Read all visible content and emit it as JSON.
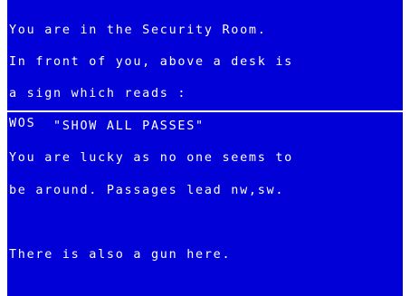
{
  "room_description": {
    "lines": [
      "You are in the Security Room.",
      "In front of you, above a desk is",
      "a sign which reads :",
      "     \"SHOW ALL PASSES\"",
      "You are lucky as no one seems to",
      "be around. Passages lead nw,sw."
    ],
    "object_line": "There is also a gun here."
  },
  "command_input": {
    "text": "WOS"
  },
  "colors": {
    "background": "#0000d7",
    "text": "#ffffff",
    "border": "#ffffff"
  }
}
